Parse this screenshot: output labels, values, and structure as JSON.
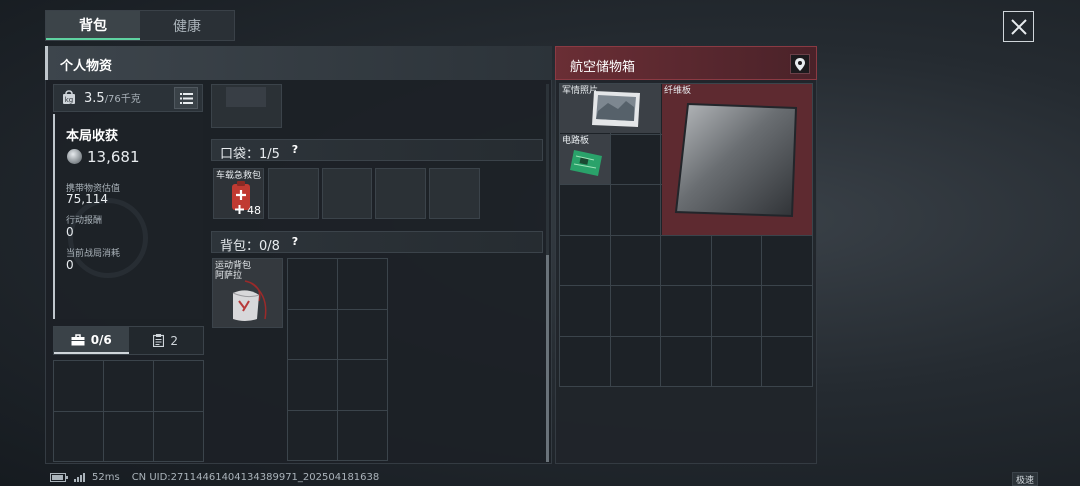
{
  "tabs": [
    {
      "label": "背包",
      "active": true
    },
    {
      "label": "健康",
      "active": false
    }
  ],
  "left_panel": {
    "title": "个人物资",
    "weight": {
      "current": "3.5",
      "max": "/76千克"
    },
    "stats": {
      "title": "本局收获",
      "value": "13,681",
      "items": [
        {
          "label": "携带物资估值",
          "value": "75,114"
        },
        {
          "label": "行动报酬",
          "value": "0"
        },
        {
          "label": "当前战局消耗",
          "value": "0"
        }
      ]
    },
    "box_tabs": [
      {
        "label": "0/6",
        "icon": "toolbox-icon",
        "active": true
      },
      {
        "label": "2",
        "icon": "clipboard-icon",
        "active": false
      }
    ],
    "pocket": {
      "label": "口袋：1/5",
      "item": {
        "name": "车载急救包",
        "count": "48"
      }
    },
    "backpack": {
      "label": "背包：0/8",
      "item": {
        "name_line1": "运动背包",
        "name_line2": "阿萨拉"
      }
    }
  },
  "right_panel": {
    "title": "航空储物箱",
    "items": [
      {
        "name": "军情照片"
      },
      {
        "name": "纤维板"
      },
      {
        "name": "电路板"
      }
    ]
  },
  "status_bar": {
    "ping": "52ms",
    "uid": "CN UID:27114461404134389971_202504181638",
    "speed_label": "极速"
  },
  "colors": {
    "accent_green": "#5fd3a1",
    "container_red": "#8a3a43",
    "item_red": "#c03a32"
  }
}
